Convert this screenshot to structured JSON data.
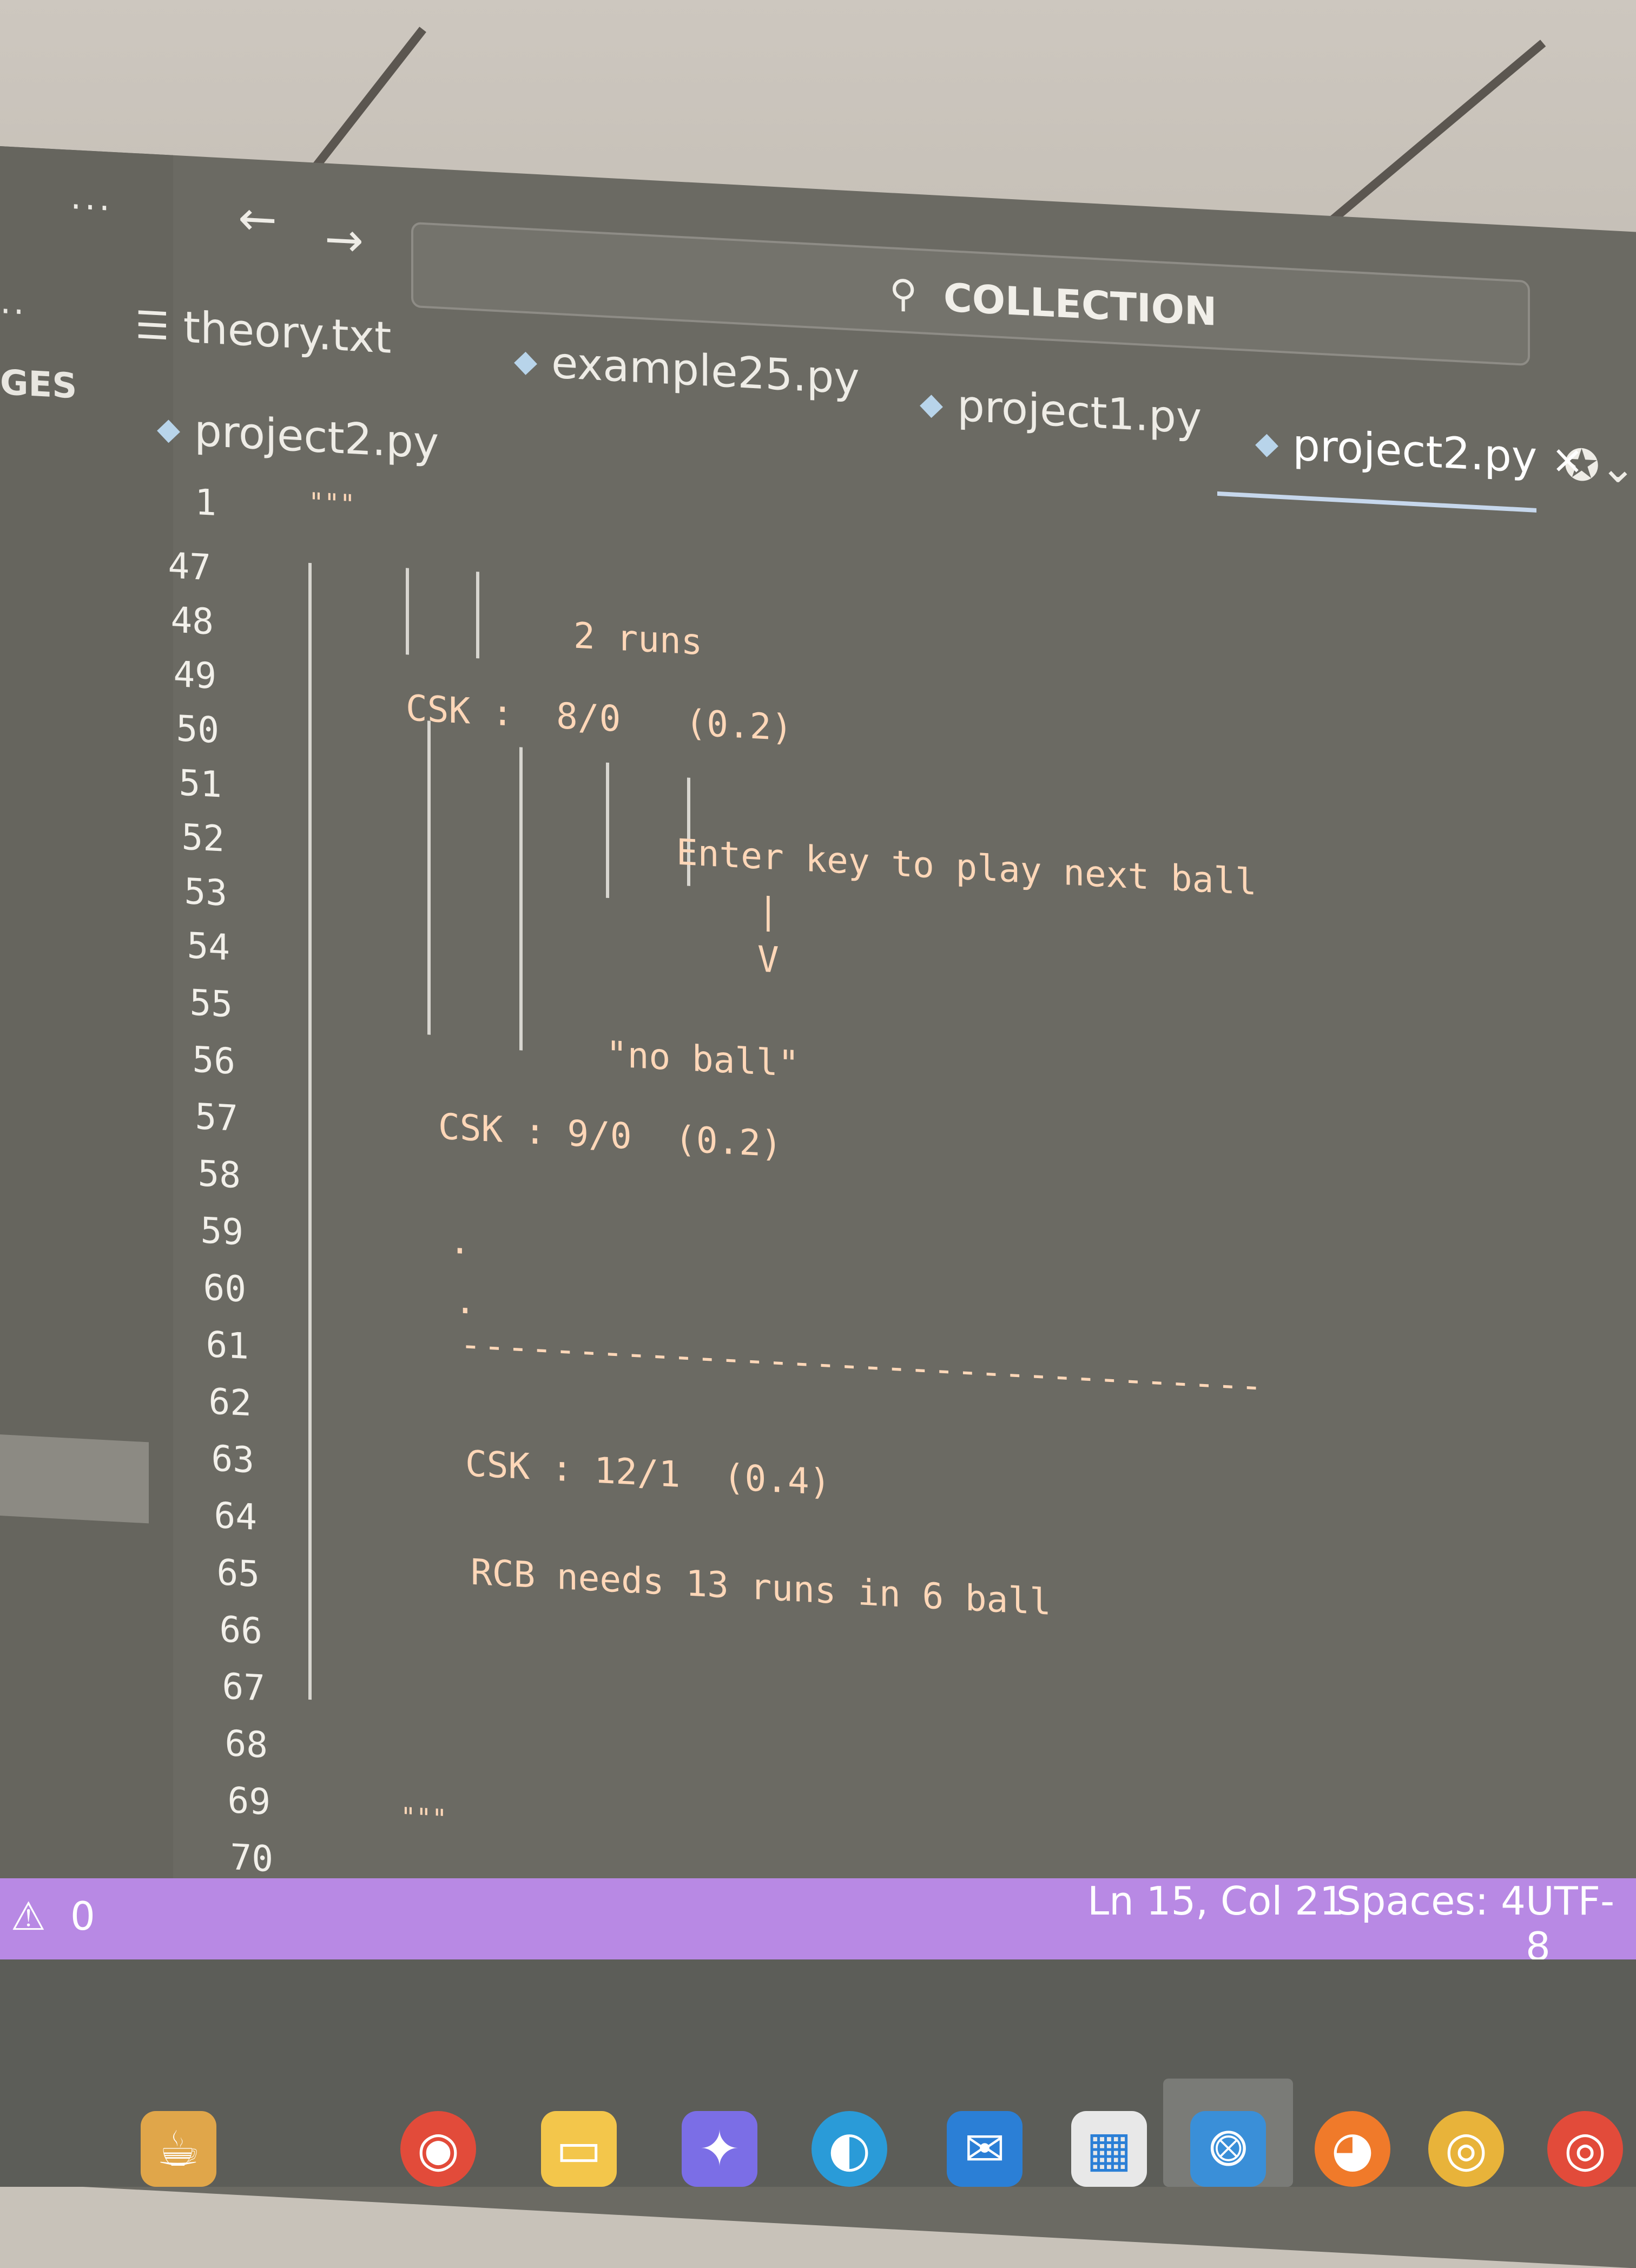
{
  "titlebar": {
    "dots": "...",
    "search_text": "COLLECTION"
  },
  "sidebar": {
    "dots": "..",
    "label": "GES"
  },
  "tabs": [
    {
      "label": "theory.txt"
    },
    {
      "label": "example25.py"
    },
    {
      "label": "project1.py"
    },
    {
      "label": "project2.py",
      "close": "×",
      "active": true
    }
  ],
  "breadcrumb": {
    "label": "project2.py"
  },
  "editor": {
    "sticky_line": {
      "num": "1",
      "text": "\"\"\""
    },
    "lines": [
      {
        "num": "47",
        "text": ""
      },
      {
        "num": "48",
        "text": "2 runs"
      },
      {
        "num": "49",
        "text": ""
      },
      {
        "num": "50",
        "text": "CSK :  8/0   (0.2)"
      },
      {
        "num": "51",
        "text": ""
      },
      {
        "num": "52",
        "text": "Enter key to play next ball"
      },
      {
        "num": "53",
        "text": "|"
      },
      {
        "num": "54",
        "text": "V"
      },
      {
        "num": "55",
        "text": ""
      },
      {
        "num": "56",
        "text": "\"no ball\""
      },
      {
        "num": "57",
        "text": "CSK : 9/0  (0.2)"
      },
      {
        "num": "58",
        "text": ""
      },
      {
        "num": "59",
        "text": "."
      },
      {
        "num": "60",
        "text": ""
      },
      {
        "num": "61",
        "text": "."
      },
      {
        "num": "62",
        "text": "----------------------------------"
      },
      {
        "num": "63",
        "text": "CSK : 12/1  (0.4)"
      },
      {
        "num": "64",
        "text": ""
      },
      {
        "num": "65",
        "text": "RCB needs 13 runs in 6 ball"
      },
      {
        "num": "66",
        "text": ""
      },
      {
        "num": "67",
        "text": ""
      },
      {
        "num": "68",
        "text": ""
      },
      {
        "num": "69",
        "text": ""
      },
      {
        "num": "70",
        "text": "\"\"\""
      }
    ]
  },
  "statusbar": {
    "warnings": "0",
    "position": "Ln 15, Col 21",
    "spaces": "Spaces: 4",
    "encoding": "UTF-8"
  },
  "taskbar": {
    "apps": [
      "widgets",
      "chrome",
      "file-explorer",
      "copilot",
      "edge",
      "mail",
      "store",
      "vscode",
      "firefox",
      "chrome-2",
      "chrome-3"
    ]
  }
}
